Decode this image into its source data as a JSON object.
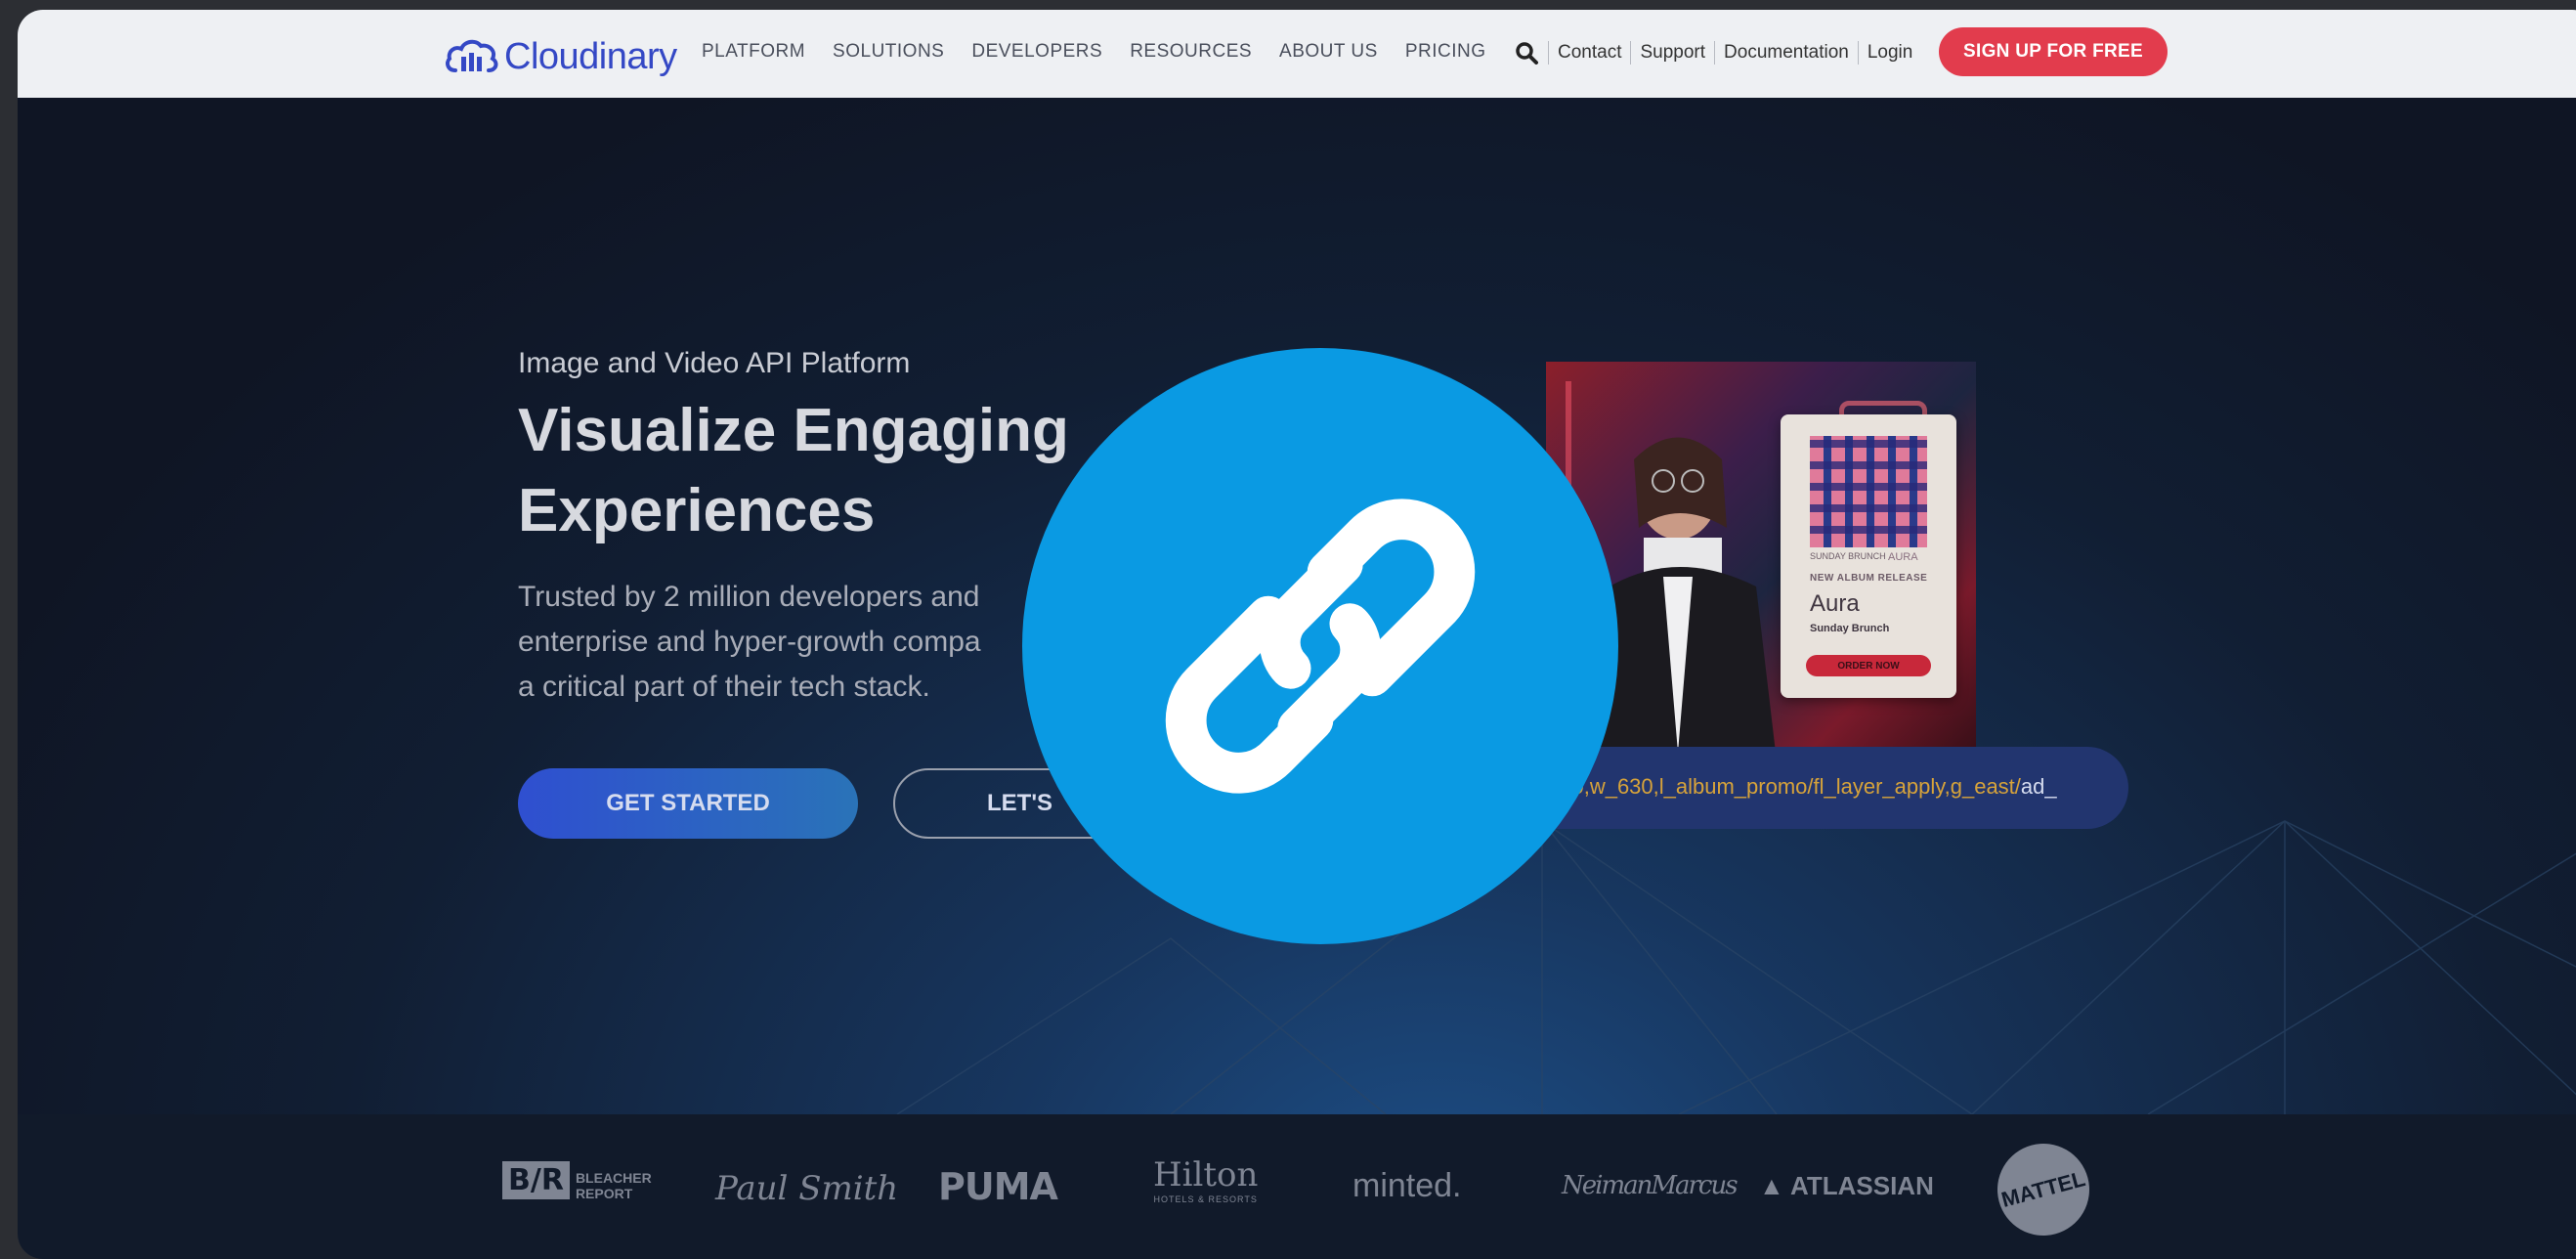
{
  "header": {
    "logo_text": "Cloudinary",
    "nav": [
      "PLATFORM",
      "SOLUTIONS",
      "DEVELOPERS",
      "RESOURCES",
      "ABOUT US",
      "PRICING"
    ],
    "utility_links": [
      "Contact",
      "Support",
      "Documentation",
      "Login"
    ],
    "signup_label": "SIGN UP FOR FREE"
  },
  "hero": {
    "eyebrow": "Image and Video API Platform",
    "title_line1": "Visualize Engaging",
    "title_line2": "Experiences",
    "subtitle_line1": "Trusted by 2 million developers and",
    "subtitle_line2": "enterprise and hyper-growth compa",
    "subtitle_line3": "a critical part of their tech stack.",
    "primary_cta": "GET STARTED",
    "secondary_cta": "LET'S"
  },
  "promo_card": {
    "album_label_left": "SUNDAY BRUNCH",
    "album_label_right": "AURA",
    "release_label": "NEW ALBUM RELEASE",
    "album_title": "Aura",
    "artist": "Sunday Brunch",
    "order_button": "ORDER NOW",
    "url_highlight": "530,w_630,l_album_promo/fl_layer_apply,g_east/",
    "url_tail": "ad_"
  },
  "logos": {
    "bleacher": "BLEACHER REPORT",
    "paul_smith": "Paul Smith",
    "puma": "PUMA",
    "hilton": "Hilton",
    "hilton_sub": "HOTELS & RESORTS",
    "minted": "minted.",
    "neiman": "NeimanMarcus",
    "atlassian": "ATLASSIAN",
    "mattel": "MATTEL"
  },
  "colors": {
    "brand_blue": "#3448c5",
    "signup_red": "#e23c4d",
    "overlay_blue": "#0a9ae3"
  },
  "overlay": {
    "icon": "link-icon"
  }
}
